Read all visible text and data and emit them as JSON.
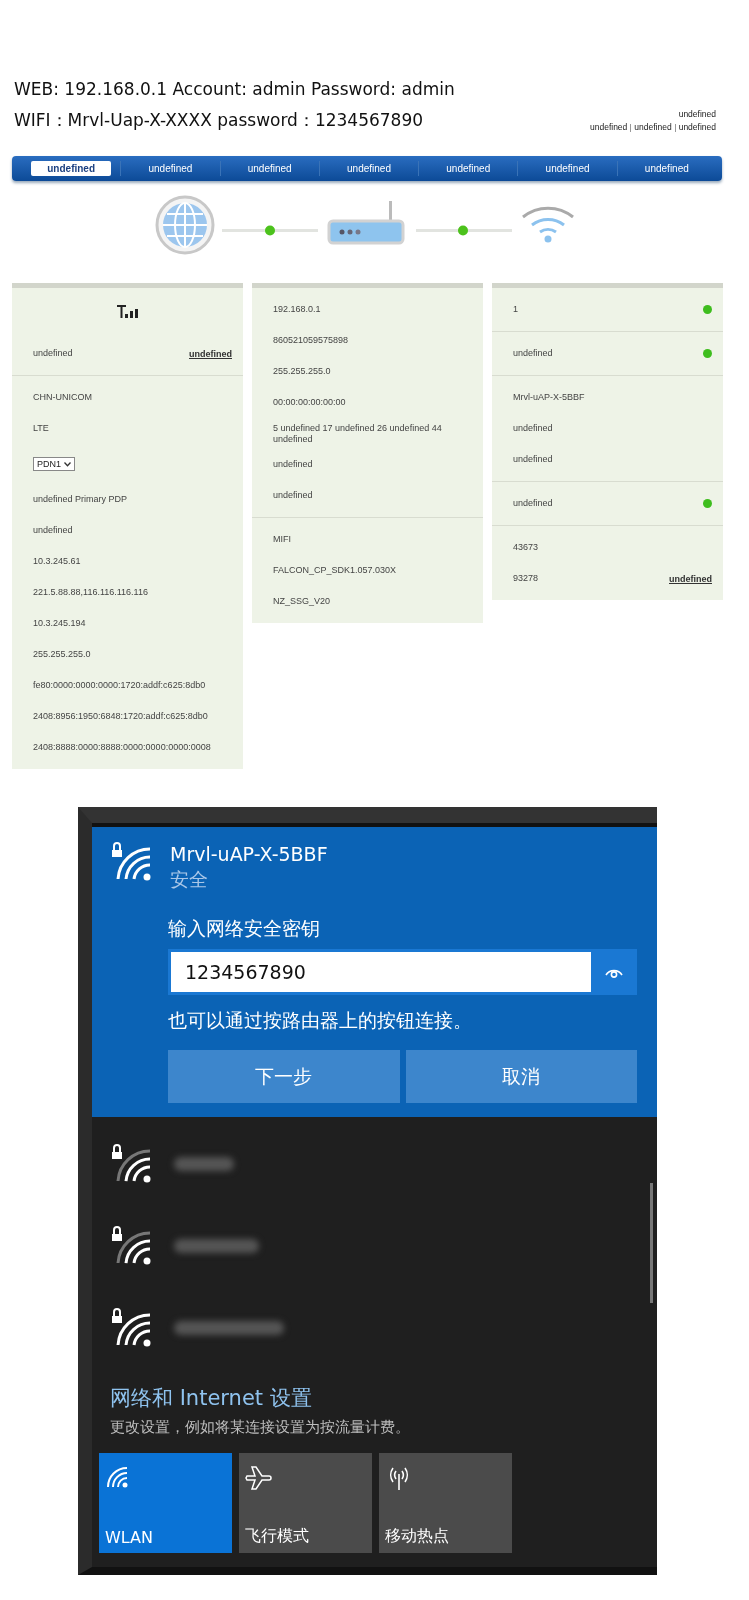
{
  "header": {
    "web_line": "WEB:  192.168.0.1 Account: admin Password: admin",
    "wifi_line": "WIFI：Mrvl-Uap-X-XXXX    password：1234567890"
  },
  "top_links": {
    "status": "undefined",
    "links": [
      "undefined",
      "undefined",
      "undefined"
    ]
  },
  "nav_tabs": [
    {
      "label": "undefined",
      "selected": true
    },
    {
      "label": "undefined",
      "selected": false
    },
    {
      "label": "undefined",
      "selected": false
    },
    {
      "label": "undefined",
      "selected": false
    },
    {
      "label": "undefined",
      "selected": false
    },
    {
      "label": "undefined",
      "selected": false
    },
    {
      "label": "undefined",
      "selected": false
    }
  ],
  "topology": {
    "links": [
      {
        "connected": true
      },
      {
        "connected": true
      }
    ]
  },
  "panels": [
    {
      "signal_icon": true,
      "sections": [
        [
          {
            "kind": "link",
            "text": "undefined",
            "link": "undefined"
          }
        ],
        [
          {
            "kind": "text",
            "text": "CHN-UNICOM"
          },
          {
            "kind": "text",
            "text": "LTE"
          },
          {
            "kind": "select",
            "value": "PDN1"
          },
          {
            "kind": "text",
            "text": "undefined Primary PDP"
          },
          {
            "kind": "text",
            "text": "undefined"
          },
          {
            "kind": "text",
            "text": "10.3.245.61"
          },
          {
            "kind": "text",
            "text": "221.5.88.88,116.116.116.116"
          },
          {
            "kind": "text",
            "text": "10.3.245.194"
          },
          {
            "kind": "text",
            "text": "255.255.255.0"
          },
          {
            "kind": "text",
            "text": "fe80:0000:0000:0000:1720:addf:c625:8db0"
          },
          {
            "kind": "text",
            "text": "2408:8956:1950:6848:1720:addf:c625:8db0"
          },
          {
            "kind": "text",
            "text": "2408:8888:0000:8888:0000:0000:0000:0008"
          }
        ]
      ]
    },
    {
      "signal_icon": false,
      "sections": [
        [
          {
            "kind": "text",
            "text": "192.168.0.1"
          },
          {
            "kind": "text",
            "text": "860521059575898"
          },
          {
            "kind": "text",
            "text": "255.255.255.0"
          },
          {
            "kind": "text",
            "text": "00:00:00:00:00:00"
          },
          {
            "kind": "text",
            "text": "5 undefined 17 undefined 26 undefined 44 undefined"
          },
          {
            "kind": "text",
            "text": "undefined"
          },
          {
            "kind": "text",
            "text": "undefined"
          }
        ],
        [
          {
            "kind": "text",
            "text": "MIFI"
          },
          {
            "kind": "text",
            "text": "FALCON_CP_SDK1.057.030X"
          },
          {
            "kind": "text",
            "text": "NZ_SSG_V20"
          }
        ]
      ]
    },
    {
      "signal_icon": false,
      "sections": [
        [
          {
            "kind": "status",
            "text": "1",
            "on": true
          }
        ],
        [
          {
            "kind": "status",
            "text": "undefined",
            "on": true
          }
        ],
        [
          {
            "kind": "text",
            "text": "Mrvl-uAP-X-5BBF"
          },
          {
            "kind": "text",
            "text": "undefined"
          },
          {
            "kind": "text",
            "text": "undefined"
          }
        ],
        [
          {
            "kind": "status",
            "text": "undefined",
            "on": true
          }
        ],
        [
          {
            "kind": "text",
            "text": "43673"
          },
          {
            "kind": "link",
            "text": "93278",
            "link": "undefined"
          }
        ]
      ]
    }
  ],
  "flyout": {
    "network": {
      "ssid": "Mrvl-uAP-X-5BBF",
      "security": "安全",
      "prompt": "输入网络安全密钥",
      "password": "1234567890",
      "hint": "也可以通过按路由器上的按钮连接。",
      "buttons": [
        "下一步",
        "取消"
      ]
    },
    "other_networks": [
      {
        "secured": true
      },
      {
        "secured": true
      },
      {
        "secured": true
      }
    ],
    "settings": {
      "title": "网络和 Internet 设置",
      "description": "更改设置，例如将某连接设置为按流量计费。"
    },
    "tiles": [
      {
        "kind": "wifi",
        "label": "WLAN",
        "on": true
      },
      {
        "kind": "airplane",
        "label": "飞行模式",
        "on": false
      },
      {
        "kind": "hotspot",
        "label": "移动热点",
        "on": false
      }
    ]
  }
}
